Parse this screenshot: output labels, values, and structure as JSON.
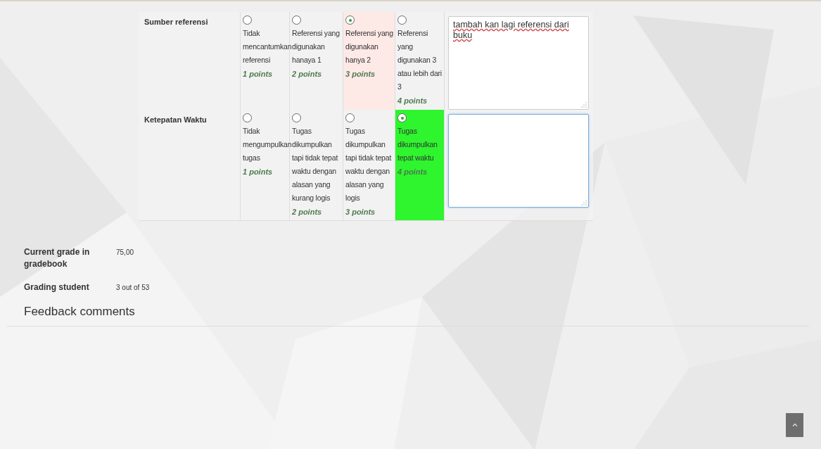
{
  "criteria": [
    {
      "label": "Sumber referensi",
      "levels": [
        {
          "description": "Tidak mencantumkan referensi",
          "points": "1 points",
          "selected": false
        },
        {
          "description": "Referensi yang digunakan hanaya 1",
          "points": "2 points",
          "selected": false
        },
        {
          "description": "Referensi yang digunakan hanya 2",
          "points": "3 points",
          "selected": true,
          "color": "#fde9e6"
        },
        {
          "description": "Referensi yang digunakan 3 atau lebih dari 3",
          "points": "4 points",
          "selected": false
        }
      ],
      "remark": {
        "value": "tambah kan lagi referensi dari buku",
        "focused": false
      }
    },
    {
      "label": "Ketepatan Waktu",
      "levels": [
        {
          "description": "Tidak mengumpulkan tugas",
          "points": "1 points",
          "selected": false
        },
        {
          "description": "Tugas dikumpulkan tapi tidak tepat waktu dengan alasan yang kurang logis",
          "points": "2 points",
          "selected": false
        },
        {
          "description": "Tugas dikumpulkan tapi tidak tepat waktu dengan alasan yang logis",
          "points": "3 points",
          "selected": false
        },
        {
          "description": "Tugas dikumpulkan tepat waktu",
          "points": "4 points",
          "selected": true,
          "color": "#2ef52e"
        }
      ],
      "remark": {
        "focused": true
      }
    }
  ],
  "summary": [
    {
      "label": "Current grade in gradebook",
      "value": "75,00"
    },
    {
      "label": "Grading student",
      "value": "3 out of 53"
    }
  ],
  "section_heading": "Feedback comments"
}
